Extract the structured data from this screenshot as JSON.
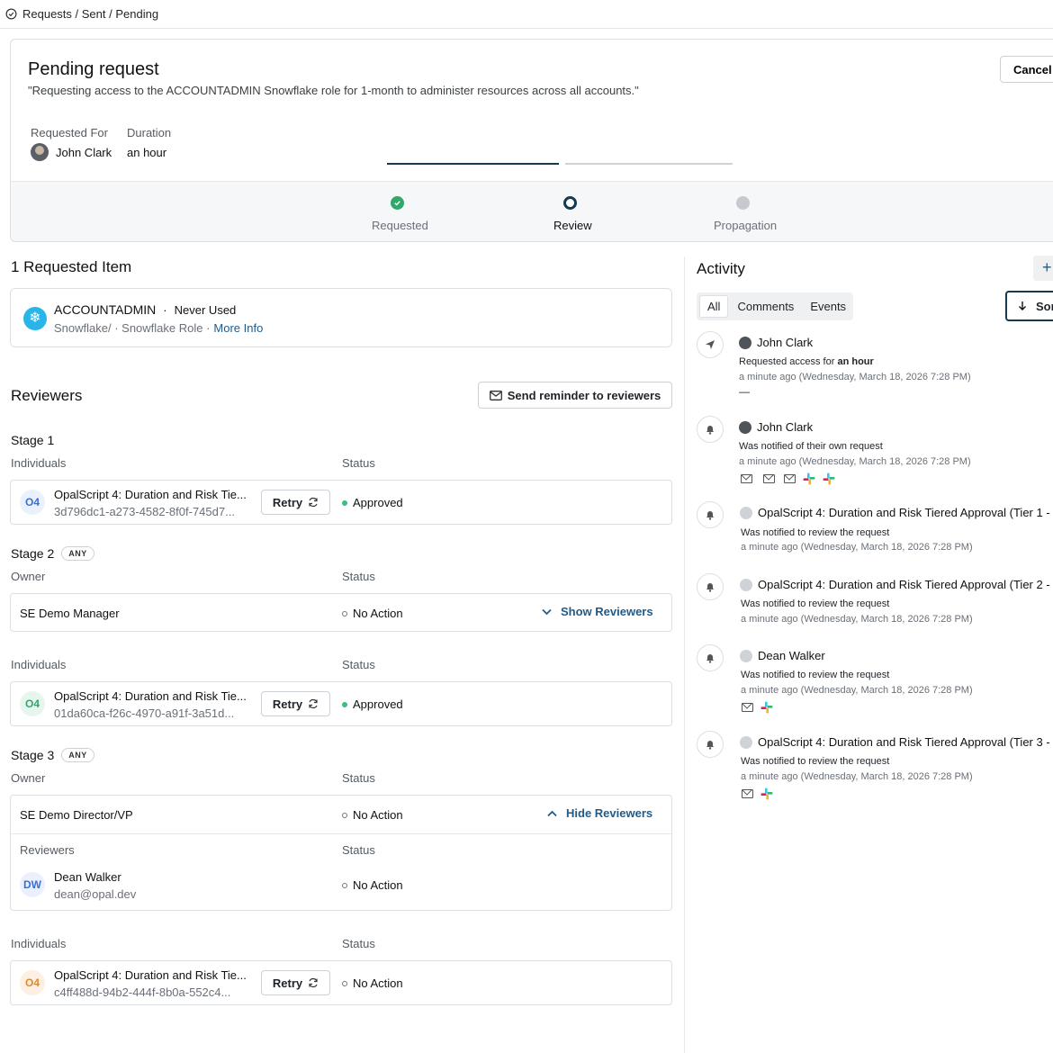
{
  "breadcrumb": "Requests / Sent / Pending",
  "header": {
    "title": "Pending request",
    "quote": "\"Requesting access to the ACCOUNTADMIN Snowflake role for 1-month to administer resources across all accounts.\"",
    "cancel_label": "Cancel",
    "requested_for_label": "Requested For",
    "requested_for_value": "John Clark",
    "duration_label": "Duration",
    "duration_value": "an hour"
  },
  "progress": {
    "steps": [
      {
        "label": "Requested",
        "state": "complete",
        "color": "#2fa86a"
      },
      {
        "label": "Review",
        "state": "current",
        "color": "#17394f"
      },
      {
        "label": "Propagation",
        "state": "pending",
        "color": "#c6cacf"
      }
    ]
  },
  "items": {
    "heading": "1 Requested Item",
    "name": "ACCOUNTADMIN",
    "separator": "·",
    "usage": "Never Used",
    "path": "Snowflake/ · Snowflake Role ·",
    "more_info": "More Info"
  },
  "reviewers": {
    "heading": "Reviewers",
    "send_reminder": "Send reminder to reviewers",
    "stage1": {
      "title": "Stage 1",
      "col_left": "Individuals",
      "col_status": "Status",
      "row": {
        "badge": "O4",
        "name": "OpalScript 4: Duration and Risk Tie...",
        "id": "3d796dc1-a273-4582-8f0f-745d7...",
        "retry": "Retry",
        "status": "Approved"
      }
    },
    "stage2": {
      "title": "Stage 2",
      "badge": "ANY",
      "col_owner": "Owner",
      "col_status": "Status",
      "owner_row": {
        "name": "SE Demo Manager",
        "status": "No Action",
        "toggle": "Show Reviewers"
      },
      "col_individuals": "Individuals",
      "col_status2": "Status",
      "row": {
        "badge": "O4",
        "name": "OpalScript 4: Duration and Risk Tie...",
        "id": "01da60ca-f26c-4970-a91f-3a51d...",
        "retry": "Retry",
        "status": "Approved"
      }
    },
    "stage3": {
      "title": "Stage 3",
      "badge": "ANY",
      "col_owner": "Owner",
      "col_status": "Status",
      "owner_row": {
        "name": "SE Demo Director/VP",
        "status": "No Action",
        "toggle": "Hide Reviewers"
      },
      "sub_col_reviewers": "Reviewers",
      "sub_col_status": "Status",
      "reviewer": {
        "initials": "DW",
        "name": "Dean Walker",
        "email": "dean@opal.dev",
        "status": "No Action"
      },
      "col_individuals": "Individuals",
      "col_status2": "Status",
      "row": {
        "badge": "O4",
        "name": "OpalScript 4: Duration and Risk Tie...",
        "id": "c4ff488d-94b2-444f-8b0a-552c4...",
        "retry": "Retry",
        "status": "No Action"
      }
    }
  },
  "activity": {
    "heading": "Activity",
    "add_label": "+",
    "tabs": [
      "All",
      "Comments",
      "Events"
    ],
    "sort_label": "Sor",
    "entries": [
      {
        "icon": "send-icon",
        "actor": "John Clark",
        "desc_prefix": "Requested access for ",
        "desc_bold": "an hour",
        "time": "a minute ago (Wednesday, March 18, 2026 7:28 PM)",
        "extra": "—"
      },
      {
        "icon": "bell-icon",
        "actor": "John Clark",
        "desc": "Was notified of their own request",
        "time": "a minute ago (Wednesday, March 18, 2026 7:28 PM)",
        "channels": [
          "mail",
          "mail",
          "mail",
          "slack",
          "slack"
        ]
      },
      {
        "icon": "bell-icon",
        "actor": "OpalScript 4: Duration and Risk Tiered Approval (Tier 1 -",
        "desc": "Was notified to review the request",
        "time": "a minute ago (Wednesday, March 18, 2026 7:28 PM)"
      },
      {
        "icon": "bell-icon",
        "actor": "OpalScript 4: Duration and Risk Tiered Approval (Tier 2 -",
        "desc": "Was notified to review the request",
        "time": "a minute ago (Wednesday, March 18, 2026 7:28 PM)"
      },
      {
        "icon": "bell-icon",
        "actor": "Dean Walker",
        "desc": "Was notified to review the request",
        "time": "a minute ago (Wednesday, March 18, 2026 7:28 PM)",
        "channels": [
          "mail",
          "slack"
        ]
      },
      {
        "icon": "bell-icon",
        "actor": "OpalScript 4: Duration and Risk Tiered Approval (Tier 3 -",
        "desc": "Was notified to review the request",
        "time": "a minute ago (Wednesday, March 18, 2026 7:28 PM)",
        "channels": [
          "mail",
          "slack"
        ]
      }
    ]
  },
  "colors": {
    "accent": "#1f5b8a",
    "approved": "#34c27b",
    "o4_blue": "#3b6fd6",
    "o4_green": "#2fa86a",
    "o4_orange": "#e0892c"
  }
}
